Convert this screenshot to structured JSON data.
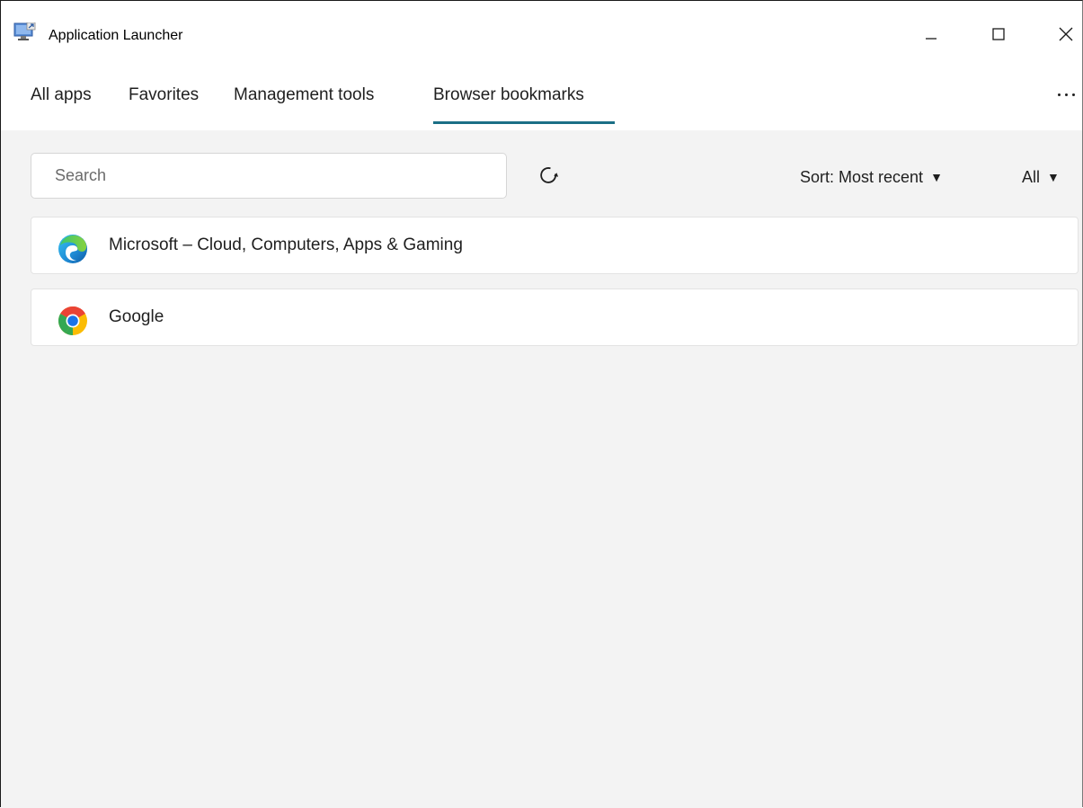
{
  "window": {
    "title": "Application Launcher",
    "icon": "remote-desktop-app-icon"
  },
  "caption_buttons": {
    "minimize": "minimize-icon",
    "maximize": "maximize-icon",
    "close": "close-icon"
  },
  "tabs": [
    {
      "label": "All apps",
      "selected": false
    },
    {
      "label": "Favorites",
      "selected": false
    },
    {
      "label": "Management tools",
      "selected": false
    },
    {
      "label": "Browser bookmarks",
      "selected": true
    }
  ],
  "toolbar": {
    "search_placeholder": "Search",
    "sort_label": "Sort: Most recent",
    "filter_label": "All",
    "refresh_icon": "refresh-icon",
    "more_icon": "more-options-icon"
  },
  "bookmarks": [
    {
      "label": "Microsoft – Cloud, Computers, Apps & Gaming",
      "icon": "edge-icon"
    },
    {
      "label": "Google",
      "icon": "chrome-icon"
    }
  ],
  "colors": {
    "accent": "#1b6f86",
    "content_background": "#f3f3f3"
  }
}
